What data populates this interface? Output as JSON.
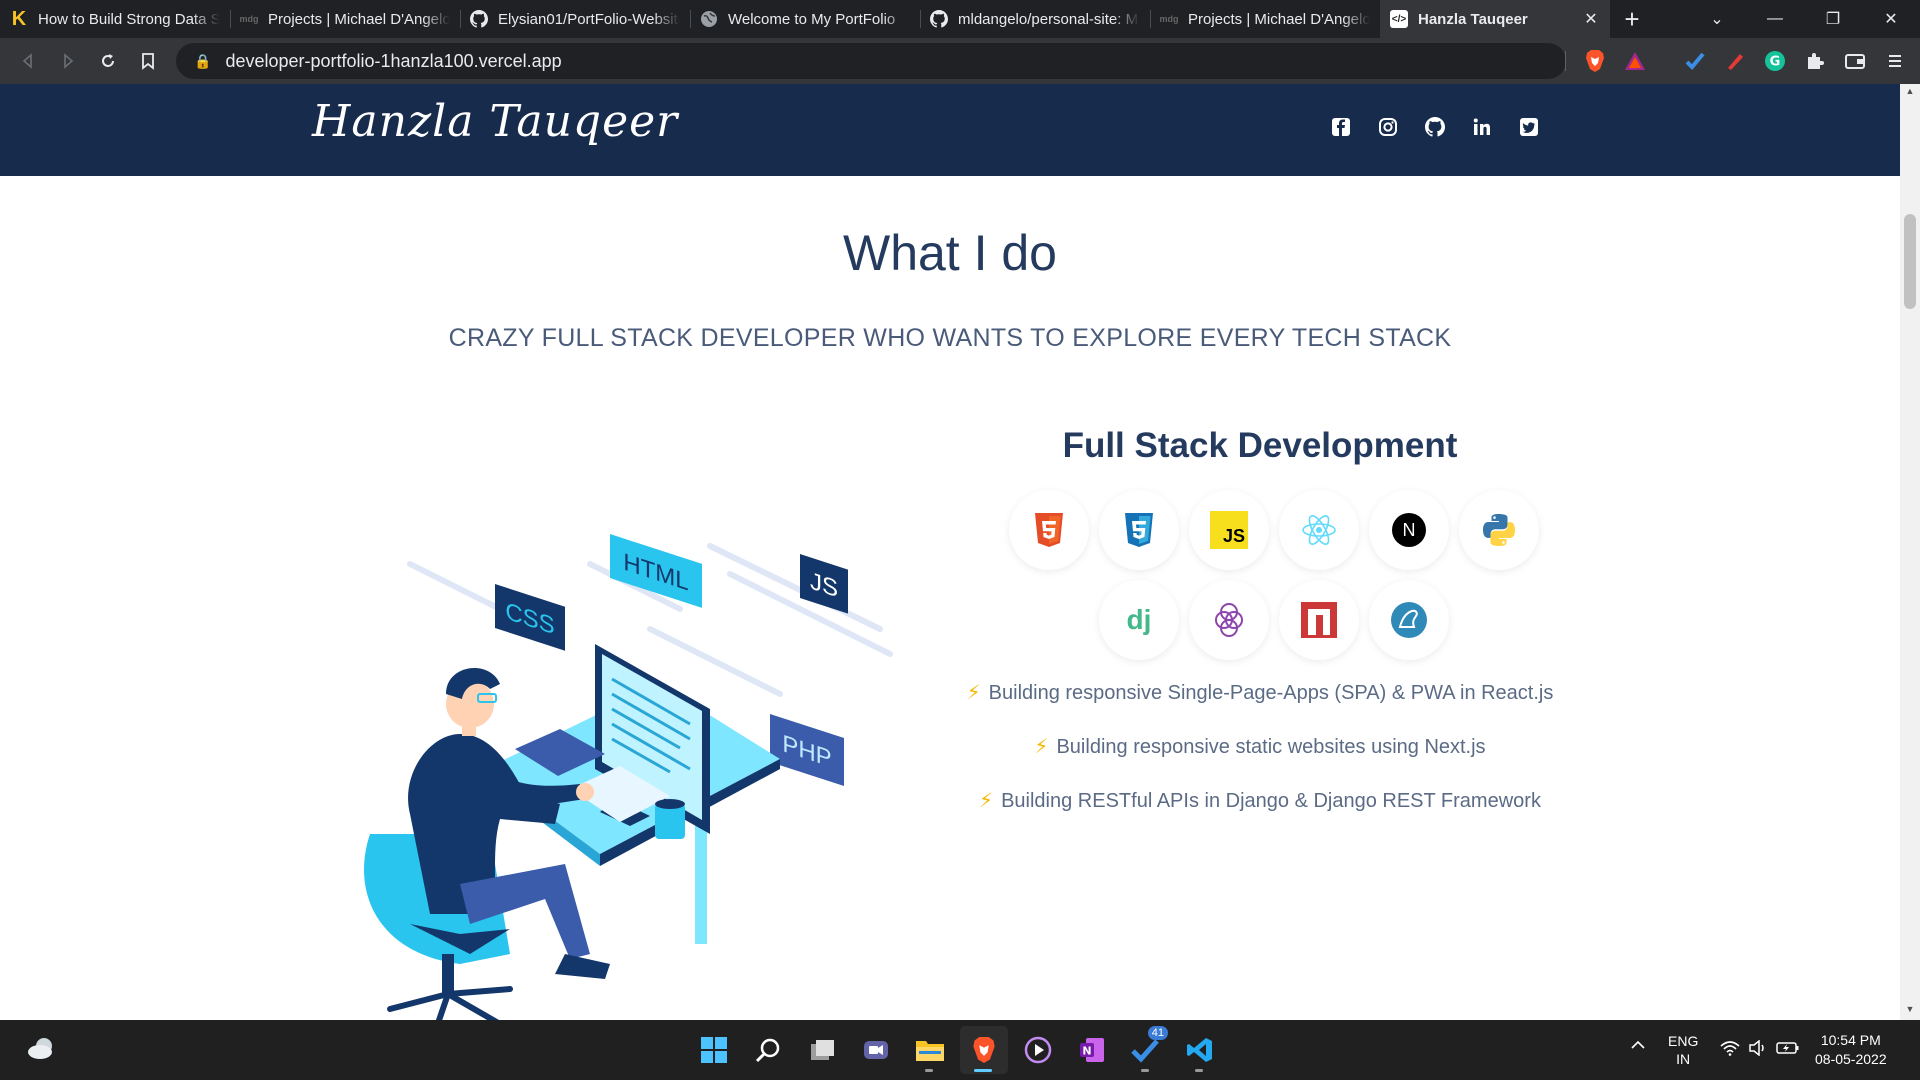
{
  "browser": {
    "tabs": [
      {
        "title": "How to Build Strong Data S",
        "favicon": "K",
        "active": false
      },
      {
        "title": "Projects | Michael D'Angelo",
        "favicon": "mdg",
        "active": false
      },
      {
        "title": "Elysian01/PortFolio-Website",
        "favicon": "github-icon",
        "active": false
      },
      {
        "title": "Welcome to My PortFolio",
        "favicon": "globe-icon",
        "active": false
      },
      {
        "title": "mldangelo/personal-site: M",
        "favicon": "github-icon",
        "active": false
      },
      {
        "title": "Projects | Michael D'Angelo",
        "favicon": "mdg",
        "active": false
      },
      {
        "title": "Hanzla Tauqeer",
        "favicon": "code-icon",
        "active": true
      }
    ],
    "url": "developer-portfolio-1hanzla100.vercel.app"
  },
  "site": {
    "logo": "Hanzla Tauqeer",
    "socials": [
      "facebook-icon",
      "instagram-icon",
      "github-icon",
      "linkedin-icon",
      "twitter-icon"
    ],
    "section_title": "What I do",
    "section_subtitle": "CRAZY FULL STACK DEVELOPER WHO WANTS TO EXPLORE EVERY TECH STACK",
    "illustration_labels": {
      "html": "HTML",
      "css": "CSS",
      "js": "JS",
      "php": "PHP"
    },
    "skill_title": "Full Stack Development",
    "skills_row1": [
      "html5-icon",
      "css3-icon",
      "javascript-icon",
      "react-icon",
      "nextjs-icon",
      "python-icon"
    ],
    "skills_row2": [
      "django-icon",
      "graphql-icon",
      "npm-icon",
      "mariadb-icon"
    ],
    "skill_labels": {
      "js": "JS",
      "next": "N",
      "django": "dj"
    },
    "features": [
      "Building responsive Single-Page-Apps (SPA) & PWA in React.js",
      "Building responsive static websites using Next.js",
      "Building RESTful APIs in Django & Django REST Framework"
    ],
    "bolt": "⚡"
  },
  "taskbar": {
    "language": "ENG",
    "region": "IN",
    "time": "10:54 PM",
    "date": "08-05-2022",
    "todo_badge": "41"
  },
  "colors": {
    "header_navy": "#172b4d",
    "title": "#243a5e",
    "accent_cyan": "#29c5ee"
  }
}
